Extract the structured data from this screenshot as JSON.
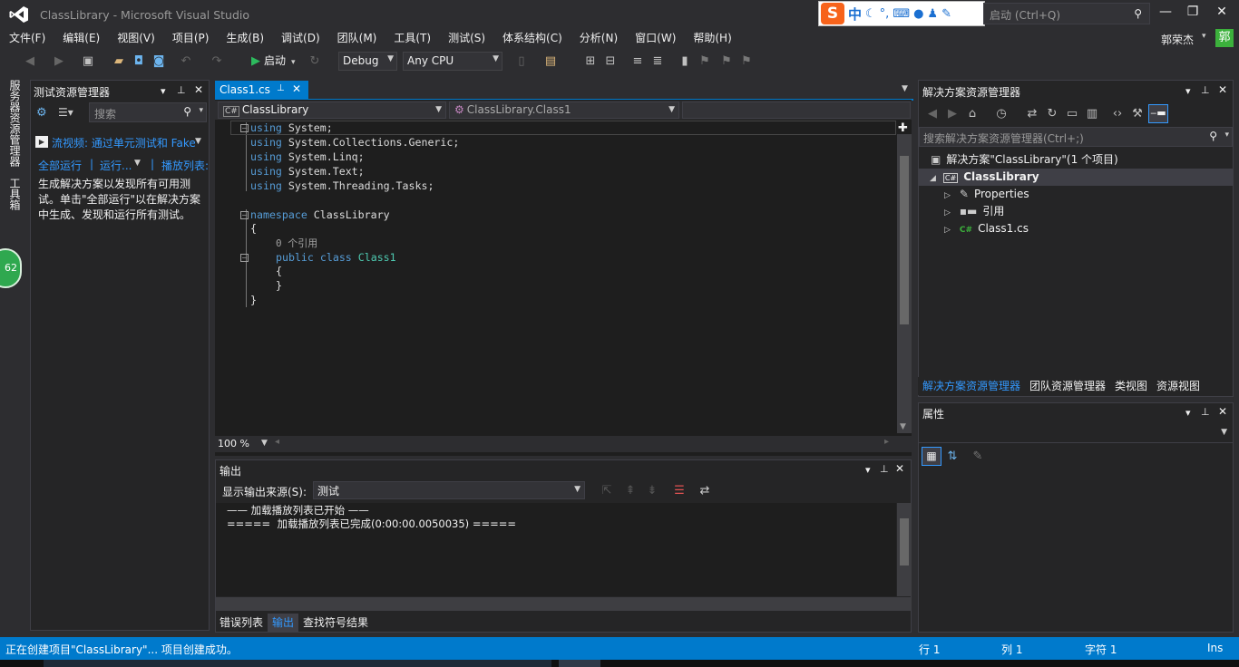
{
  "window": {
    "title": "ClassLibrary - Microsoft Visual Studio",
    "quick_launch_placeholder": "快速启动 (Ctrl+Q)",
    "quick_launch_visible": "启动 (Ctrl+Q)",
    "ime_label": "中",
    "ime_logo": "S"
  },
  "menu": [
    "文件(F)",
    "编辑(E)",
    "视图(V)",
    "项目(P)",
    "生成(B)",
    "调试(D)",
    "团队(M)",
    "工具(T)",
    "测试(S)",
    "体系结构(C)",
    "分析(N)",
    "窗口(W)",
    "帮助(H)"
  ],
  "user": {
    "name": "郭荣杰",
    "avatar": "郭"
  },
  "toolbar": {
    "start_label": "启动",
    "config": "Debug",
    "platform": "Any CPU"
  },
  "left_strip": {
    "tab1": "服务器资源管理器",
    "tab2": "工具箱",
    "badge": "62"
  },
  "test_explorer": {
    "title": "测试资源管理器",
    "search_placeholder": "搜索",
    "video_link": "流视频: 通过单元测试和 Fake",
    "run_all": "全部运行",
    "run": "运行...",
    "playlist": "播放列表:",
    "message": "生成解决方案以发现所有可用测试。单击\"全部运行\"以在解决方案中生成、发现和运行所有测试。"
  },
  "editor": {
    "tab_label": "Class1.cs",
    "nav_project": "ClassLibrary",
    "nav_class": "ClassLibrary.Class1",
    "zoom": "100 %",
    "code": {
      "l1_kw": "using",
      "l1_rest": " System;",
      "l2_kw": "using",
      "l2_rest": " System.Collections.Generic;",
      "l3_kw": "using",
      "l3_rest": " System.Linq;",
      "l4_kw": "using",
      "l4_rest": " System.Text;",
      "l5_kw": "using",
      "l5_rest": " System.Threading.Tasks;",
      "l7_kw": "namespace",
      "l7_rest": " ClassLibrary",
      "l8": "{",
      "l9_ref": "0 个引用",
      "l10_kw1": "public",
      "l10_kw2": "class",
      "l10_type": "Class1",
      "l11": "{",
      "l12": "}",
      "l13": "}"
    }
  },
  "output": {
    "title": "输出",
    "source_label": "显示输出来源(S):",
    "source_value": "测试",
    "line1": "—— 加载播放列表已开始 ——",
    "line2": "=====  加载播放列表已完成(0:00:00.0050035) ====="
  },
  "bottom_tabs": [
    "错误列表",
    "输出",
    "查找符号结果"
  ],
  "solution_explorer": {
    "title": "解决方案资源管理器",
    "search_placeholder": "搜索解决方案资源管理器(Ctrl+;)",
    "solution": "解决方案\"ClassLibrary\"(1 个项目)",
    "project": "ClassLibrary",
    "items": [
      "Properties",
      "引用",
      "Class1.cs"
    ],
    "tabs": [
      "解决方案资源管理器",
      "团队资源管理器",
      "类视图",
      "资源视图"
    ]
  },
  "properties": {
    "title": "属性"
  },
  "status": {
    "message": "正在创建项目\"ClassLibrary\"... 项目创建成功。",
    "row": "行 1",
    "col": "列 1",
    "char": "字符 1",
    "mode": "Ins"
  },
  "colors": {
    "accent": "#007acc",
    "keyword": "#569cd6",
    "type": "#4ec9b0",
    "link": "#3399ff",
    "start_green": "#2dbb5e"
  }
}
